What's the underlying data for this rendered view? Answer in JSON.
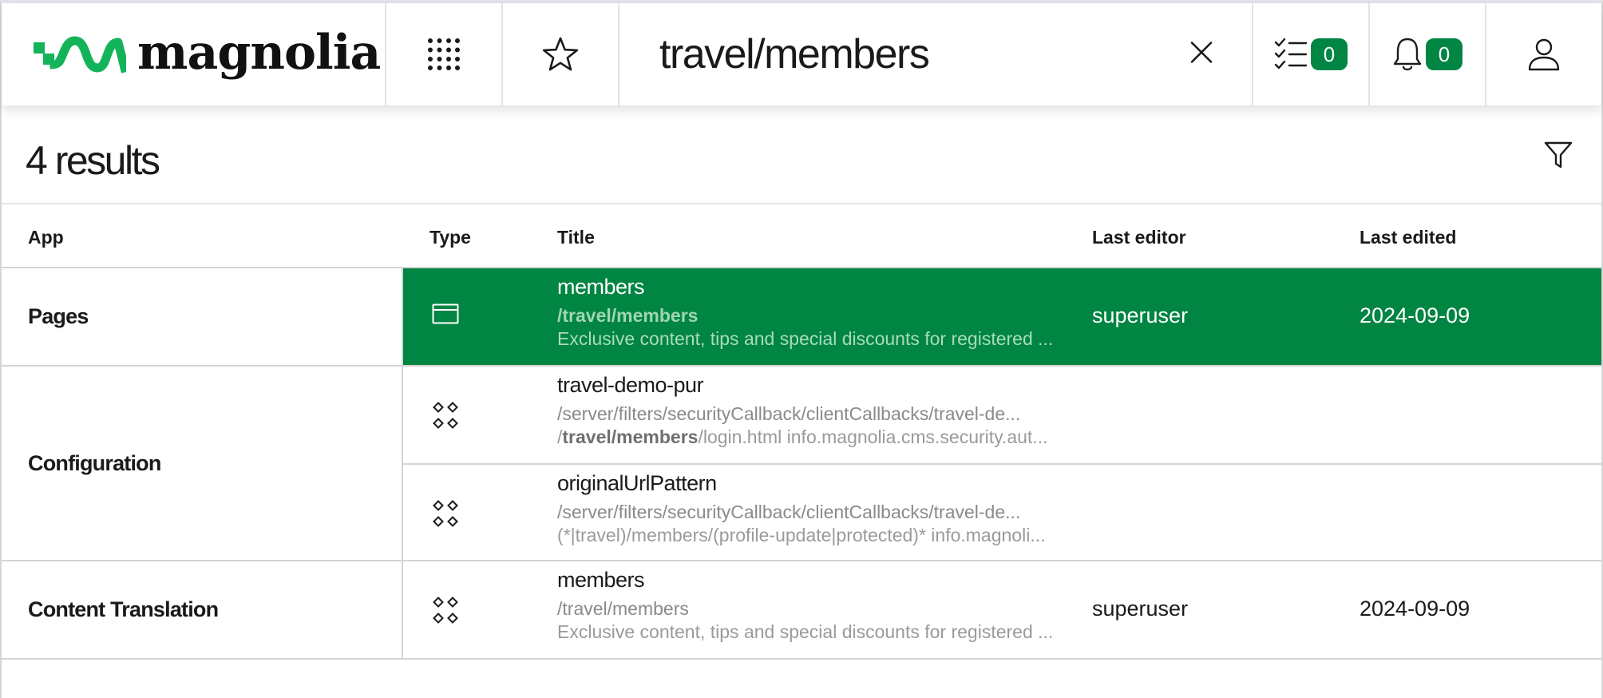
{
  "header": {
    "logo_text": "magnolia",
    "search": {
      "value": "travel/members",
      "placeholder": ""
    },
    "tasks_count": "0",
    "notifications_count": "0"
  },
  "results": {
    "count_label": "4 results"
  },
  "table": {
    "columns": {
      "app": "App",
      "type": "Type",
      "title": "Title",
      "editor": "Last editor",
      "edited": "Last edited"
    },
    "groups": [
      {
        "app": "Pages",
        "rows": [
          {
            "type_icon": "page-icon",
            "title": "members",
            "path": "/travel/members",
            "description": "Exclusive content, tips and special discounts for registered ...",
            "editor": "superuser",
            "edited": "2024-09-09",
            "selected": true
          }
        ]
      },
      {
        "app": "Configuration",
        "rows": [
          {
            "type_icon": "config-node-icon",
            "title": "travel-demo-pur",
            "path": "/server/filters/securityCallback/clientCallbacks/travel-de...",
            "description_prefix": "/",
            "description_highlight": "travel/members",
            "description_suffix": "/login.html info.magnolia.cms.security.aut...",
            "editor": "",
            "edited": ""
          },
          {
            "type_icon": "config-node-icon",
            "title": "originalUrlPattern",
            "path": "/server/filters/securityCallback/clientCallbacks/travel-de...",
            "description": "(*|travel)/members/(profile-update|protected)* info.magnoli...",
            "editor": "",
            "edited": ""
          }
        ]
      },
      {
        "app": "Content Translation",
        "rows": [
          {
            "type_icon": "config-node-icon",
            "title": "members",
            "path": "/travel/members",
            "description": "Exclusive content, tips and special discounts for registered ...",
            "editor": "superuser",
            "edited": "2024-09-09"
          }
        ]
      }
    ]
  },
  "colors": {
    "accent": "#008542",
    "logo_green": "#13b35a",
    "border": "#d4d4d4"
  }
}
